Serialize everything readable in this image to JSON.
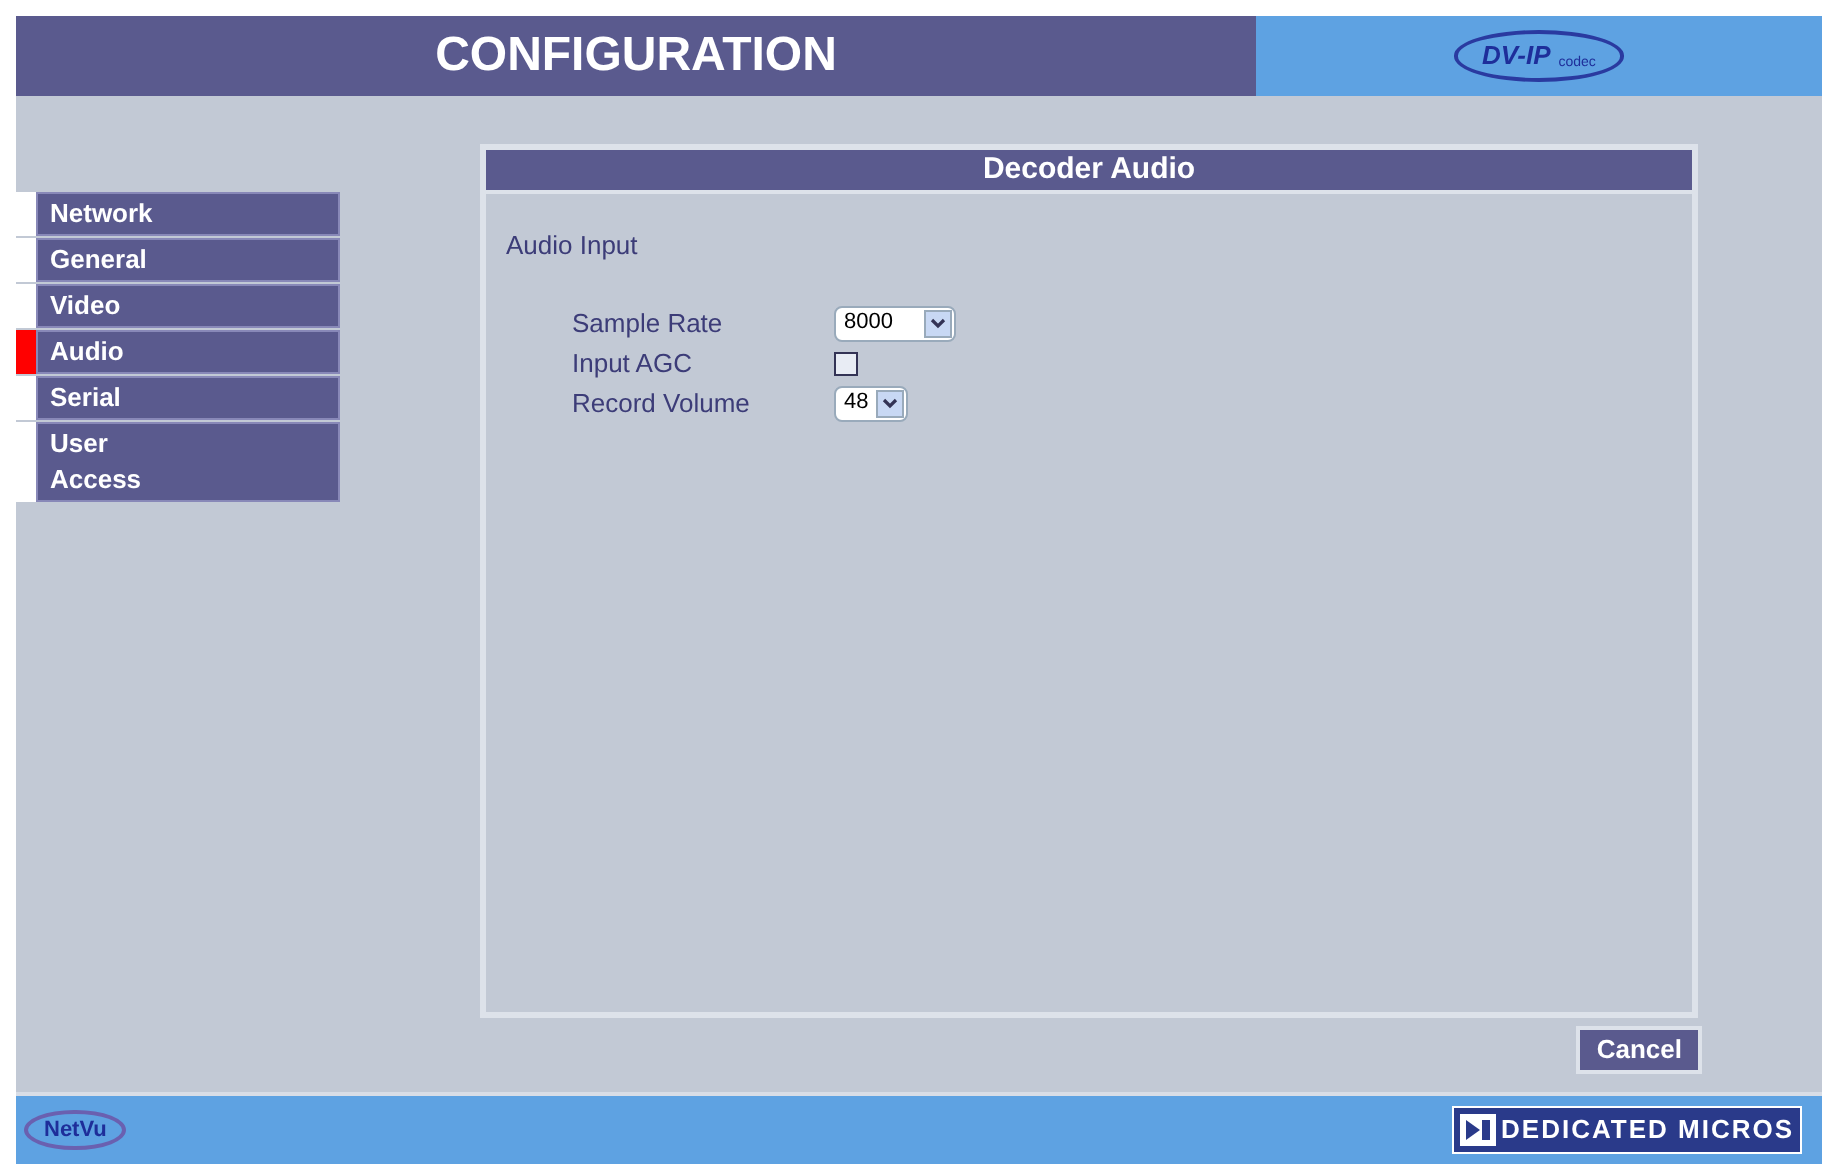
{
  "header": {
    "title": "CONFIGURATION",
    "logo": {
      "main": "DV-IP",
      "sub": "codec"
    }
  },
  "sidebar": {
    "items": [
      {
        "label": "Network",
        "selected": false
      },
      {
        "label": "General",
        "selected": false
      },
      {
        "label": "Video",
        "selected": false
      },
      {
        "label": "Audio",
        "selected": true
      },
      {
        "label": "Serial",
        "selected": false
      },
      {
        "label": "User Access",
        "selected": false
      }
    ]
  },
  "panel": {
    "title": "Decoder Audio",
    "section": "Audio Input",
    "fields": [
      {
        "kind": "select",
        "label": "Sample Rate",
        "value": "8000"
      },
      {
        "kind": "checkbox",
        "label": "Input AGC",
        "checked": false
      },
      {
        "kind": "select",
        "label": "Record Volume",
        "value": "48"
      }
    ]
  },
  "buttons": [
    "Cancel"
  ],
  "footer": {
    "left_logo": "NetVu",
    "right_logo": "DEDICATED MICROS"
  }
}
